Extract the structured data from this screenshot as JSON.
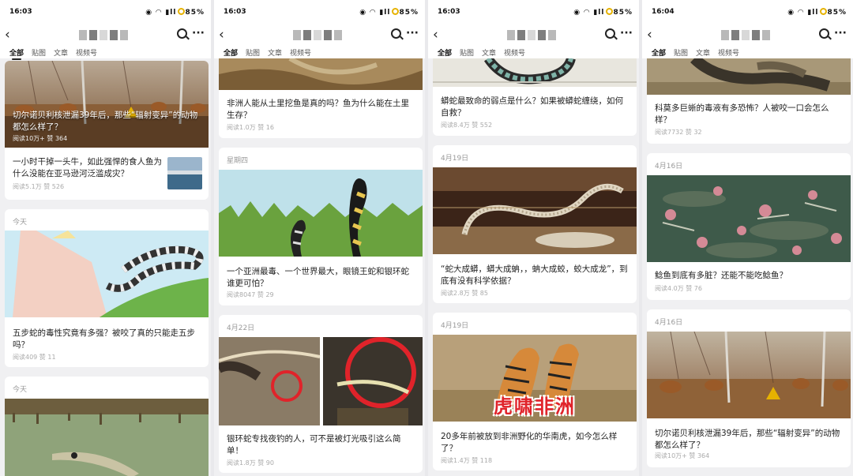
{
  "panels": [
    {
      "time": "16:03",
      "status_icons": "◉ ◠ ▮ll",
      "battery": "85%",
      "tabs": [
        "全部",
        "贴图",
        "文章",
        "视频号"
      ],
      "cards": [
        {
          "title": "切尔诺贝利核泄漏39年后，那些“辐射变异”的动物都怎么样了？",
          "meta": "阅读10万+  赞 364",
          "image": "deer-field"
        },
        {
          "title": "一小时干掉一头牛，如此强悍的食人鱼为什么没能在亚马逊河泛滥成灾？",
          "meta": "阅读5.1万  赞 526",
          "image": "lake-thumb"
        },
        {
          "date": "今天",
          "title": "五步蛇的毒性究竟有多强？被咬了真的只能走五步吗？",
          "meta": "阅读409  赞 11",
          "image": "snake-bite"
        },
        {
          "date": "今天",
          "title": "",
          "meta": "",
          "image": "fish-water"
        }
      ]
    },
    {
      "time": "16:03",
      "status_icons": "◉ ◠ ▮ll",
      "battery": "85%",
      "tabs": [
        "全部",
        "贴图",
        "文章",
        "视频号"
      ],
      "cards": [
        {
          "title": "非洲人能从土里挖鱼是真的吗？鱼为什么能在土里生存？",
          "meta": "阅读1.0万  赞 16",
          "image": "mud"
        },
        {
          "date": "星期四",
          "title": "一个亚洲最毒、一个世界最大，眼镜王蛇和银环蛇谁更可怕？",
          "meta": "阅读8047  赞 29",
          "image": "cobra-cartoon"
        },
        {
          "date": "4月22日",
          "title": "银环蛇专找夜钓的人，可不是被灯光吸引这么简单！",
          "meta": "阅读1.8万  赞 90",
          "image": "krait-circle"
        }
      ]
    },
    {
      "time": "16:03",
      "status_icons": "◉ ◠ ▮ll",
      "battery": "85%",
      "tabs": [
        "全部",
        "贴图",
        "文章",
        "视频号"
      ],
      "cards": [
        {
          "title": "蟒蛇最致命的弱点是什么？如果被蟒蛇缠绕，如何自救？",
          "meta": "阅读8.4万  赞 552",
          "image": "python-illus"
        },
        {
          "date": "4月19日",
          "title": "“蛇大成蟒，蟒大成蚺，，蚺大成蛟，蛟大成龙”，到底有没有科学依据？",
          "meta": "阅读2.8万  赞 85",
          "image": "skeleton"
        },
        {
          "date": "4月19日",
          "title": "20多年前被放到非洲野化的华南虎，如今怎么样了？",
          "meta": "阅读1.4万  赞 118",
          "image": "tigers",
          "caption": "虎啸非洲"
        }
      ]
    },
    {
      "time": "16:04",
      "status_icons": "◉ ◠ ▮ll",
      "battery": "85%",
      "tabs": [
        "全部",
        "贴图",
        "文章",
        "视频号"
      ],
      "cards": [
        {
          "title": "科莫多巨蜥的毒液有多恐怖？人被咬一口会怎么样？",
          "meta": "阅读7732  赞 32",
          "image": "komodo"
        },
        {
          "date": "4月16日",
          "title": "鲶鱼到底有多脏？还能不能吃鲶鱼？",
          "meta": "阅读4.0万  赞 76",
          "image": "catfish"
        },
        {
          "date": "4月16日",
          "title": "切尔诺贝利核泄漏39年后，那些“辐射变异”的动物都怎么样了？",
          "meta": "阅读10万+  赞 364",
          "image": "deer-field"
        }
      ]
    }
  ],
  "colors": {
    "card": "#ffffff",
    "page": "#f0f0f2",
    "meta": "#aaaaaa",
    "accent": "#e6b200",
    "caption_red": "#e0232a"
  }
}
